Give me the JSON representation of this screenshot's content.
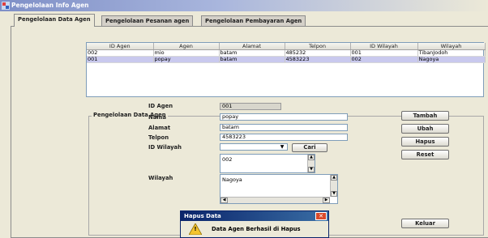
{
  "window": {
    "title": "Pengelolaan Info Agen"
  },
  "tabs": [
    {
      "label": "Pengelolaan Data Agen",
      "active": true
    },
    {
      "label": "Pengelolaan Pesanan agen",
      "active": false
    },
    {
      "label": "Pengelolaan Pembayaran Agen",
      "active": false
    }
  ],
  "table": {
    "columns": [
      "ID Agen",
      "Agen",
      "Alamat",
      "Telpon",
      "ID Wilayah",
      "Wilayah"
    ],
    "rows": [
      [
        "002",
        "mio",
        "batam",
        "485232",
        "001",
        "TibanJodoh"
      ],
      [
        "001",
        "popay",
        "batam",
        "4583223",
        "002",
        "Nagoya"
      ]
    ],
    "selected_row": 1
  },
  "form": {
    "group_title": "Pengelolaan Data Agen",
    "id_agen_label": "ID Agen",
    "id_agen_value": "001",
    "nama_label": "Nama",
    "nama_value": "popay",
    "alamat_label": "Alamat",
    "alamat_value": "batam",
    "telpon_label": "Telpon",
    "telpon_value": "4583223",
    "id_wilayah_label": "ID Wilayah",
    "id_wilayah_value": "",
    "cari_label": "Cari",
    "id_wilayah_list": "002",
    "wilayah_label": "Wilayah",
    "wilayah_list": "Nagoya"
  },
  "buttons": {
    "tambah": "Tambah",
    "ubah": "Ubah",
    "hapus": "Hapus",
    "reset": "Reset",
    "keluar": "Keluar"
  },
  "dialog": {
    "title": "Hapus Data",
    "message": "Data Agen Berhasil di Hapus",
    "close_glyph": "✕",
    "warning_glyph": "!"
  },
  "colors": {
    "title_bar": "#7e8fc7",
    "selection": "#c9c9ee",
    "dialog_title": "#0a246a"
  }
}
